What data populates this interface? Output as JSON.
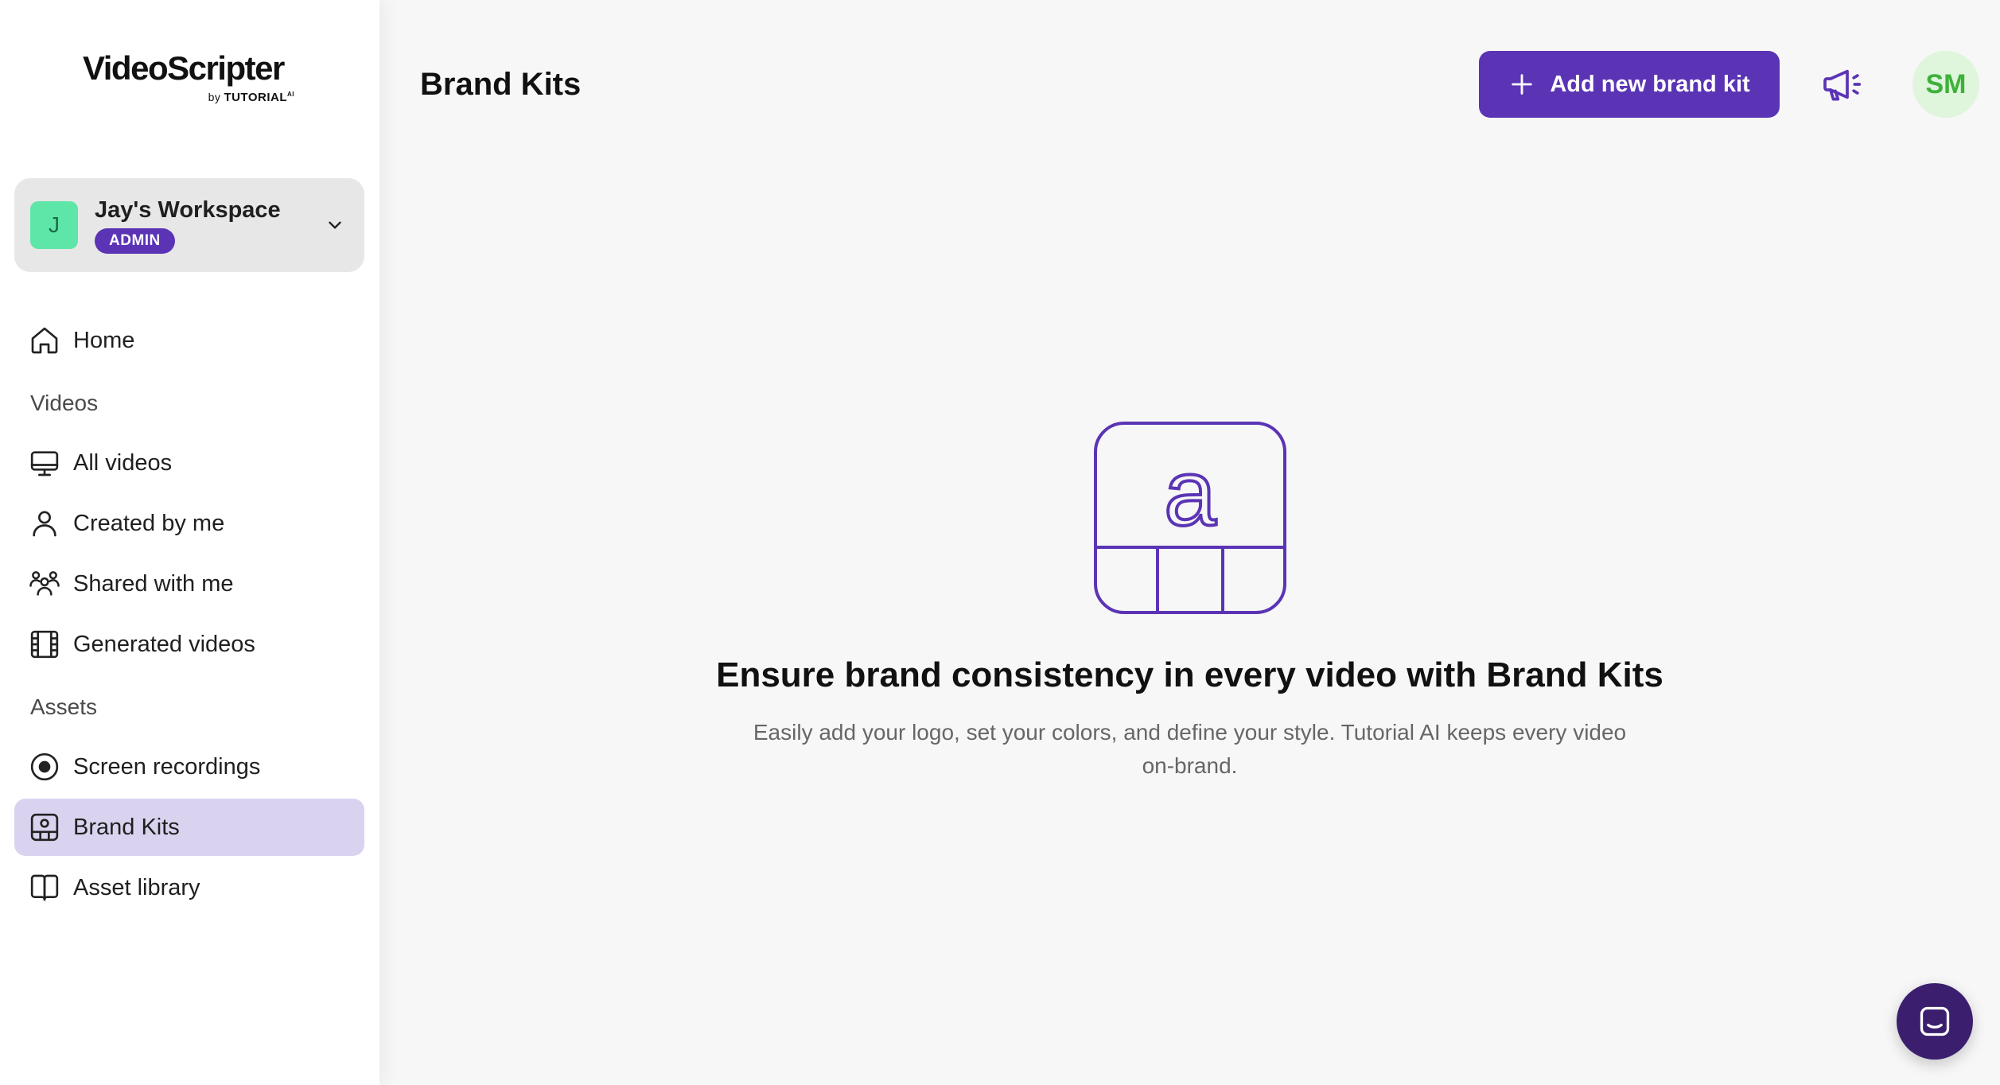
{
  "brand": {
    "name": "VideoScripter",
    "by": "by",
    "company": "TUTORIAL",
    "company_sup": "AI"
  },
  "workspace": {
    "initial": "J",
    "name": "Jay's Workspace",
    "role": "ADMIN"
  },
  "nav": {
    "home": "Home",
    "section_videos": "Videos",
    "all_videos": "All videos",
    "created_by_me": "Created by me",
    "shared_with_me": "Shared with me",
    "generated_videos": "Generated videos",
    "section_assets": "Assets",
    "screen_recordings": "Screen recordings",
    "brand_kits": "Brand Kits",
    "asset_library": "Asset library"
  },
  "header": {
    "title": "Brand Kits",
    "add_button": "Add new brand kit",
    "user_initials": "SM"
  },
  "empty_state": {
    "icon_letter": "a",
    "title": "Ensure brand consistency in every video with Brand Kits",
    "description": "Easily add your logo, set your colors, and define your style. Tutorial AI keeps every video on-brand."
  },
  "colors": {
    "accent": "#5b34b5",
    "active_nav": "#d9d3ef",
    "workspace_avatar": "#5ee6a8",
    "user_avatar_bg": "#dff5dc",
    "user_avatar_fg": "#3db13a",
    "chat_button": "#3b1f6e"
  }
}
